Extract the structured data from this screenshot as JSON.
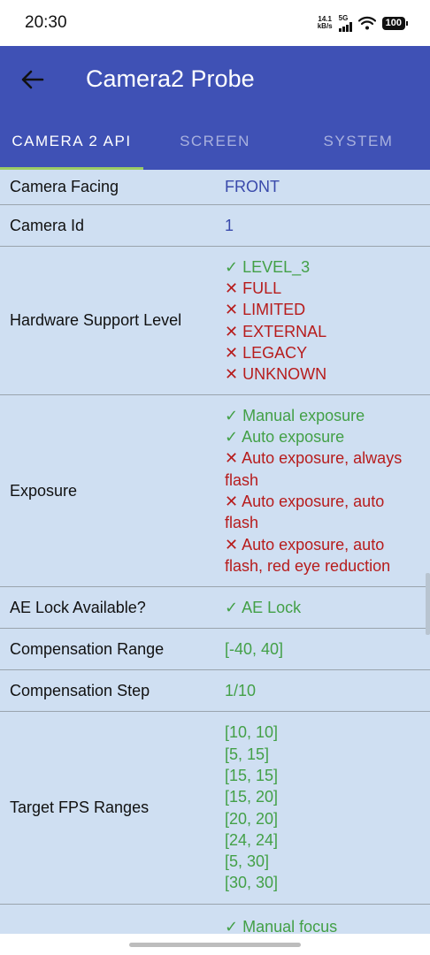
{
  "status": {
    "time": "20:30",
    "speed_value": "14.1",
    "speed_unit": "kB/s",
    "network": "5G",
    "battery": "100"
  },
  "appbar": {
    "title": "Camera2 Probe",
    "back_icon": "arrow-left-icon"
  },
  "tabs": [
    {
      "label": "CAMERA 2 API",
      "active": true
    },
    {
      "label": "SCREEN",
      "active": false
    },
    {
      "label": "SYSTEM",
      "active": false
    }
  ],
  "colors": {
    "primary": "#3f51b5",
    "tab_indicator": "#9ccc65",
    "content_bg": "#cfdff2",
    "supported": "#43a047",
    "unsupported": "#b71c1c",
    "info": "#3949ab"
  },
  "rows": [
    {
      "label": "Camera Facing",
      "lines": [
        {
          "text": "FRONT",
          "kind": "blue"
        }
      ]
    },
    {
      "label": "Camera Id",
      "lines": [
        {
          "text": "1",
          "kind": "blue"
        }
      ]
    },
    {
      "label": "Hardware Support Level",
      "lines": [
        {
          "text": "✓ LEVEL_3",
          "kind": "green"
        },
        {
          "text": "✕ FULL",
          "kind": "red"
        },
        {
          "text": "✕ LIMITED",
          "kind": "red"
        },
        {
          "text": "✕ EXTERNAL",
          "kind": "red"
        },
        {
          "text": "✕ LEGACY",
          "kind": "red"
        },
        {
          "text": "✕ UNKNOWN",
          "kind": "red"
        }
      ]
    },
    {
      "label": "Exposure",
      "lines": [
        {
          "text": "✓ Manual exposure",
          "kind": "green"
        },
        {
          "text": "✓ Auto exposure",
          "kind": "green"
        },
        {
          "text": "✕ Auto exposure, always flash",
          "kind": "red"
        },
        {
          "text": "✕ Auto exposure, auto flash",
          "kind": "red"
        },
        {
          "text": "✕ Auto exposure, auto flash, red eye reduction",
          "kind": "red"
        }
      ]
    },
    {
      "label": "AE Lock Available?",
      "lines": [
        {
          "text": "✓ AE Lock",
          "kind": "green"
        }
      ]
    },
    {
      "label": "Compensation Range",
      "lines": [
        {
          "text": "[-40, 40]",
          "kind": "green"
        }
      ]
    },
    {
      "label": "Compensation Step",
      "lines": [
        {
          "text": "1/10",
          "kind": "green"
        }
      ]
    },
    {
      "label": "Target FPS Ranges",
      "lines": [
        {
          "text": "[10, 10]",
          "kind": "green"
        },
        {
          "text": "[5, 15]",
          "kind": "green"
        },
        {
          "text": "[15, 15]",
          "kind": "green"
        },
        {
          "text": "[15, 20]",
          "kind": "green"
        },
        {
          "text": "[20, 20]",
          "kind": "green"
        },
        {
          "text": "[24, 24]",
          "kind": "green"
        },
        {
          "text": "[5, 30]",
          "kind": "green"
        },
        {
          "text": "[30, 30]",
          "kind": "green"
        }
      ]
    },
    {
      "label": "",
      "lines": [
        {
          "text": "✓ Manual focus",
          "kind": "green"
        }
      ]
    }
  ]
}
